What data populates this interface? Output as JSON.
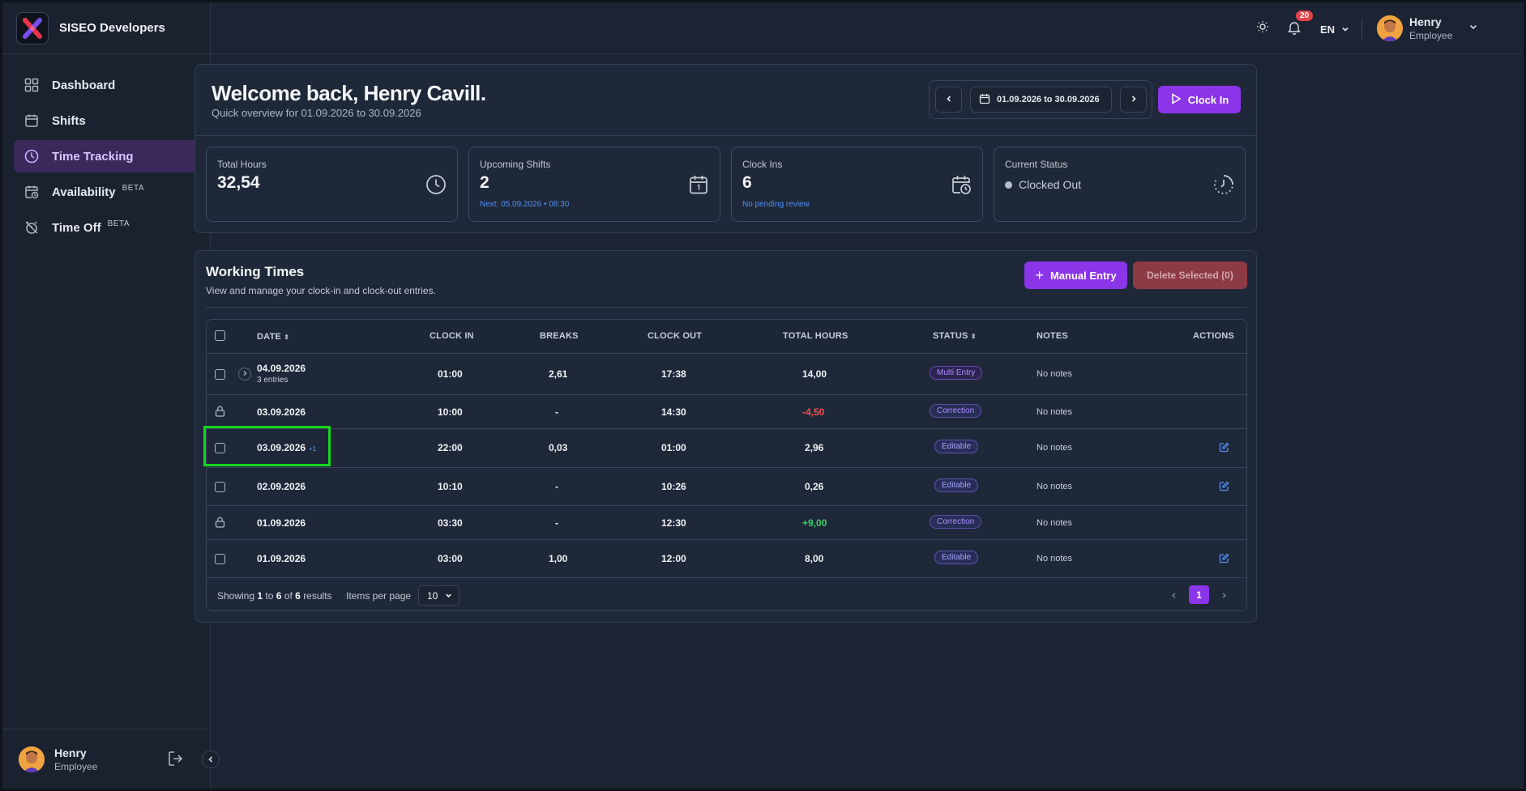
{
  "brand": {
    "name": "SISEO Developers"
  },
  "sidebar": {
    "items": [
      {
        "label": "Dashboard",
        "icon": "grid-icon"
      },
      {
        "label": "Shifts",
        "icon": "calendar-icon"
      },
      {
        "label": "Time Tracking",
        "icon": "clock-icon",
        "active": true
      },
      {
        "label": "Availability",
        "icon": "calendar-clock-icon",
        "badge": "BETA"
      },
      {
        "label": "Time Off",
        "icon": "alarm-off-icon",
        "badge": "BETA"
      }
    ],
    "user": {
      "name": "Henry",
      "role": "Employee"
    }
  },
  "topbar": {
    "notifications_count": "20",
    "language": "EN",
    "user": {
      "name": "Henry",
      "role": "Employee"
    }
  },
  "welcome": {
    "title": "Welcome back, Henry Cavill.",
    "subtitle": "Quick overview for 01.09.2026 to 30.09.2026",
    "date_range": "01.09.2026 to 30.09.2026",
    "clock_in_label": "Clock In"
  },
  "stats": {
    "total_hours": {
      "label": "Total Hours",
      "value": "32,54"
    },
    "upcoming_shifts": {
      "label": "Upcoming Shifts",
      "value": "2",
      "note": "Next: 05.09.2026 • 08:30"
    },
    "clock_ins": {
      "label": "Clock Ins",
      "value": "6",
      "note": "No pending review"
    },
    "current_status": {
      "label": "Current Status",
      "value": "Clocked Out"
    }
  },
  "working_times": {
    "title": "Working Times",
    "subtitle": "View and manage your clock-in and clock-out entries.",
    "manual_entry_label": "Manual Entry",
    "delete_selected_label": "Delete Selected (0)",
    "columns": {
      "date": "DATE",
      "clock_in": "CLOCK IN",
      "breaks": "BREAKS",
      "clock_out": "CLOCK OUT",
      "total_hours": "TOTAL HOURS",
      "status": "STATUS",
      "notes": "NOTES",
      "actions": "ACTIONS"
    },
    "rows": [
      {
        "date": "04.09.2026",
        "entries": "3 entries",
        "clock_in": "01:00",
        "breaks": "2,61",
        "clock_out": "17:38",
        "total": "14,00",
        "status": "Multi Entry",
        "notes": "No notes"
      },
      {
        "date": "03.09.2026",
        "clock_in": "10:00",
        "breaks": "-",
        "clock_out": "14:30",
        "total": "-4,50",
        "status": "Correction",
        "notes": "No notes"
      },
      {
        "date": "03.09.2026",
        "extra": "+1",
        "clock_in": "22:00",
        "breaks": "0,03",
        "clock_out": "01:00",
        "total": "2,96",
        "status": "Editable",
        "notes": "No notes"
      },
      {
        "date": "02.09.2026",
        "clock_in": "10:10",
        "breaks": "-",
        "clock_out": "10:26",
        "total": "0,26",
        "status": "Editable",
        "notes": "No notes"
      },
      {
        "date": "01.09.2026",
        "clock_in": "03:30",
        "breaks": "-",
        "clock_out": "12:30",
        "total": "+9,00",
        "status": "Correction",
        "notes": "No notes"
      },
      {
        "date": "01.09.2026",
        "clock_in": "03:00",
        "breaks": "1,00",
        "clock_out": "12:00",
        "total": "8,00",
        "status": "Editable",
        "notes": "No notes"
      }
    ],
    "footer": {
      "showing_prefix": "Showing",
      "from": "1",
      "to_word": "to",
      "to": "6",
      "of_word": "of",
      "total": "6",
      "results_word": "results",
      "items_per_page_label": "Items per page",
      "items_per_page": "10",
      "current_page": "1"
    }
  }
}
